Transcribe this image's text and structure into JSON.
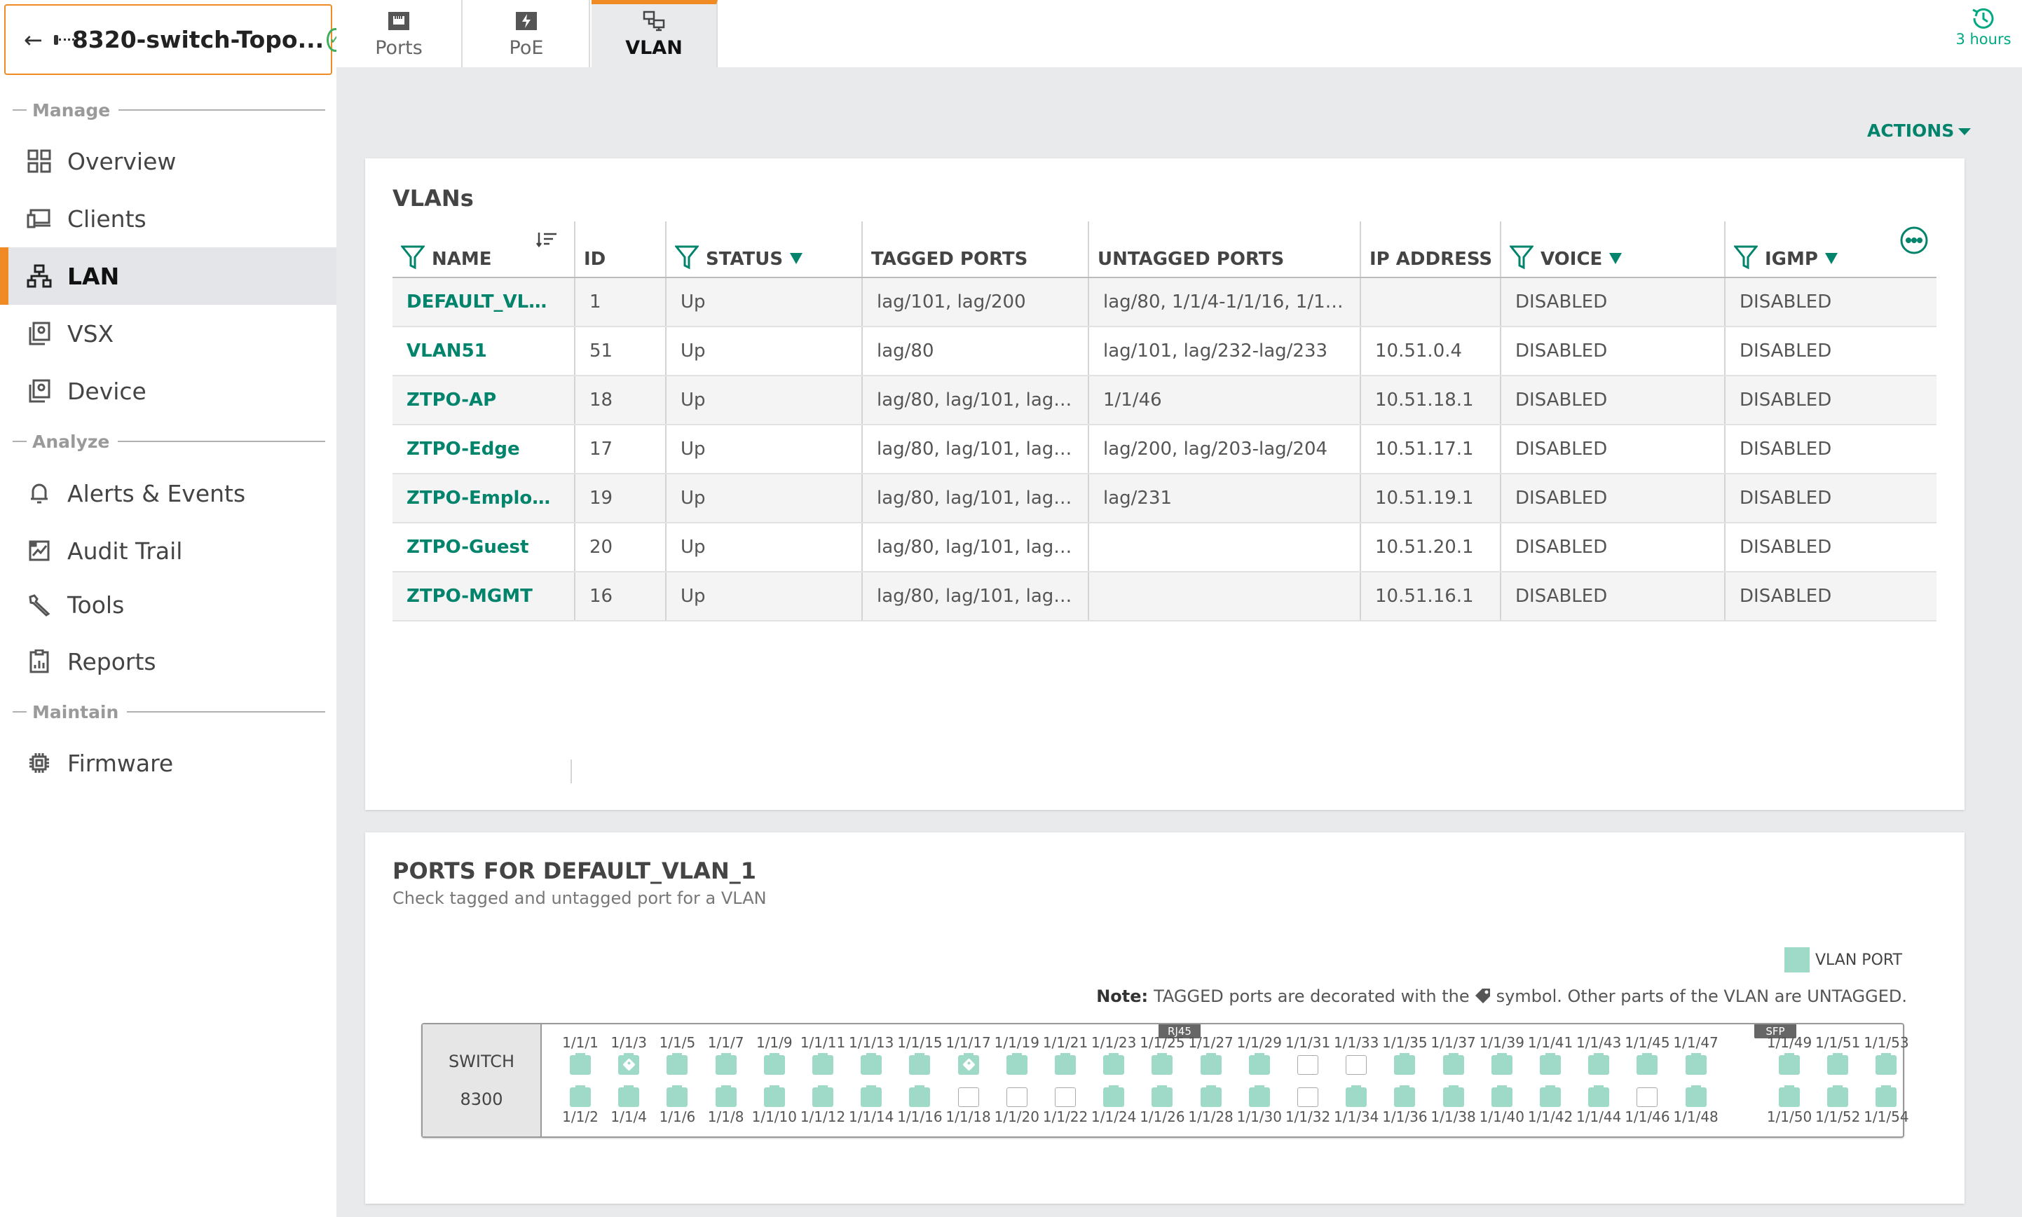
{
  "device": {
    "title": "8320-switch-Topo..."
  },
  "sidebar": {
    "sections": {
      "manage": "Manage",
      "analyze": "Analyze",
      "maintain": "Maintain"
    },
    "items": [
      {
        "label": "Overview",
        "icon": "grid-icon"
      },
      {
        "label": "Clients",
        "icon": "devices-icon"
      },
      {
        "label": "LAN",
        "icon": "network-icon",
        "active": true
      },
      {
        "label": "VSX",
        "icon": "stack-icon"
      },
      {
        "label": "Device",
        "icon": "stack-icon"
      },
      {
        "label": "Alerts & Events",
        "icon": "bell-icon"
      },
      {
        "label": "Audit Trail",
        "icon": "chart-box-icon"
      },
      {
        "label": "Tools",
        "icon": "wrench-icon"
      },
      {
        "label": "Reports",
        "icon": "report-icon"
      },
      {
        "label": "Firmware",
        "icon": "chip-icon"
      }
    ]
  },
  "tabs": [
    {
      "label": "Ports",
      "icon": "port-icon"
    },
    {
      "label": "PoE",
      "icon": "poe-icon"
    },
    {
      "label": "VLAN",
      "icon": "vlan-icon",
      "active": true
    }
  ],
  "history": {
    "label": "3 hours",
    "icon": "history-icon"
  },
  "actions": {
    "label": "ACTIONS"
  },
  "vlans": {
    "title": "VLANs",
    "columns": [
      "NAME",
      "ID",
      "STATUS",
      "TAGGED PORTS",
      "UNTAGGED PORTS",
      "IP ADDRESS",
      "VOICE",
      "IGMP"
    ],
    "rows": [
      [
        "DEFAULT_VLA...",
        "1",
        "Up",
        "lag/101, lag/200",
        "lag/80, 1/1/4-1/1/16, 1/1/...",
        "",
        "DISABLED",
        "DISABLED"
      ],
      [
        "VLAN51",
        "51",
        "Up",
        "lag/80",
        "lag/101, lag/232-lag/233",
        "10.51.0.4",
        "DISABLED",
        "DISABLED"
      ],
      [
        "ZTPO-AP",
        "18",
        "Up",
        "lag/80, lag/101, lag/...",
        "1/1/46",
        "10.51.18.1",
        "DISABLED",
        "DISABLED"
      ],
      [
        "ZTPO-Edge",
        "17",
        "Up",
        "lag/80, lag/101, lag/...",
        "lag/200, lag/203-lag/204",
        "10.51.17.1",
        "DISABLED",
        "DISABLED"
      ],
      [
        "ZTPO-Employ...",
        "19",
        "Up",
        "lag/80, lag/101, lag/...",
        "lag/231",
        "10.51.19.1",
        "DISABLED",
        "DISABLED"
      ],
      [
        "ZTPO-Guest",
        "20",
        "Up",
        "lag/80, lag/101, lag/...",
        "",
        "10.51.20.1",
        "DISABLED",
        "DISABLED"
      ],
      [
        "ZTPO-MGMT",
        "16",
        "Up",
        "lag/80, lag/101, lag/...",
        "",
        "10.51.16.1",
        "DISABLED",
        "DISABLED"
      ]
    ]
  },
  "ports_panel": {
    "title": "PORTS FOR DEFAULT_VLAN_1",
    "subtitle": "Check tagged and untagged port for a VLAN",
    "legend": "VLAN PORT",
    "note_label": "Note:",
    "note_pre": "TAGGED ports are decorated with the",
    "note_post": "symbol. Other parts of the VLAN are UNTAGGED.",
    "switch_label": "SWITCH",
    "switch_model": "8300",
    "group_rj45": "RJ45",
    "group_sfp": "SFP",
    "port_count": 54,
    "off_ports": [
      18,
      20,
      22,
      31,
      32,
      33,
      46
    ],
    "tagged_ports": [
      3,
      17
    ],
    "accent": "#01846b",
    "port_color": "#9fd9c7"
  }
}
